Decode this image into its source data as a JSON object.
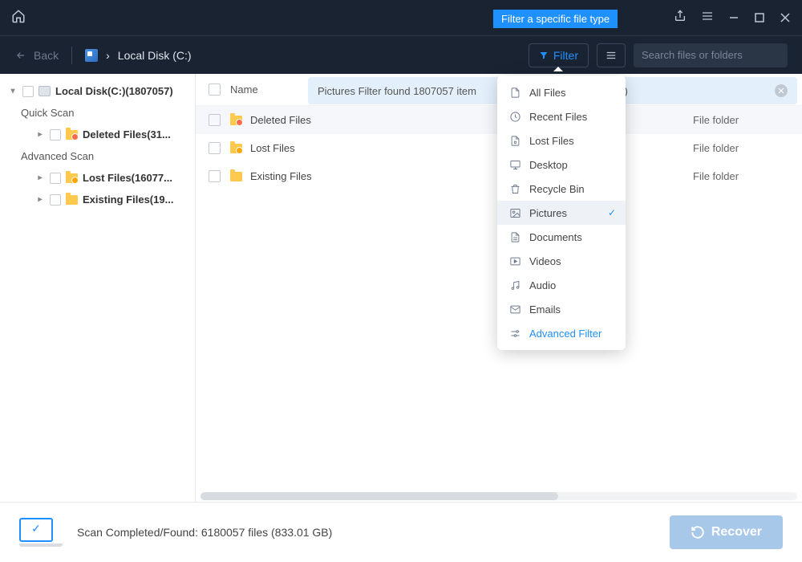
{
  "titlebar": {
    "tooltip": "Filter a specific file type"
  },
  "nav": {
    "back": "Back",
    "breadcrumb_sep": "›",
    "location": "Local Disk (C:)",
    "filter": "Filter",
    "search_placeholder": "Search files or folders"
  },
  "sidebar": {
    "root": "Local Disk(C:)(1807057)",
    "quick": "Quick Scan",
    "deleted": "Deleted Files(31...",
    "advanced": "Advanced Scan",
    "lost": "Lost Files(16077...",
    "existing": "Existing Files(19..."
  },
  "content": {
    "banner": "Pictures Filter found 1807057 item",
    "banner_tail": "00)",
    "header_name": "Name",
    "rows": [
      {
        "name": "Deleted Files",
        "type": "File folder",
        "variant": "del"
      },
      {
        "name": "Lost Files",
        "type": "File folder",
        "variant": "lost"
      },
      {
        "name": "Existing Files",
        "type": "File folder",
        "variant": ""
      }
    ]
  },
  "dropdown": {
    "items": [
      {
        "label": "All Files",
        "icon": "file"
      },
      {
        "label": "Recent Files",
        "icon": "clock"
      },
      {
        "label": "Lost Files",
        "icon": "lost"
      },
      {
        "label": "Desktop",
        "icon": "desktop"
      },
      {
        "label": "Recycle Bin",
        "icon": "bin"
      },
      {
        "label": "Pictures",
        "icon": "picture",
        "selected": true
      },
      {
        "label": "Documents",
        "icon": "doc"
      },
      {
        "label": "Videos",
        "icon": "video"
      },
      {
        "label": "Audio",
        "icon": "audio"
      },
      {
        "label": "Emails",
        "icon": "email"
      }
    ],
    "advanced": "Advanced Filter"
  },
  "footer": {
    "status": "Scan Completed/Found: 6180057 files (833.01 GB)",
    "recover": "Recover"
  }
}
